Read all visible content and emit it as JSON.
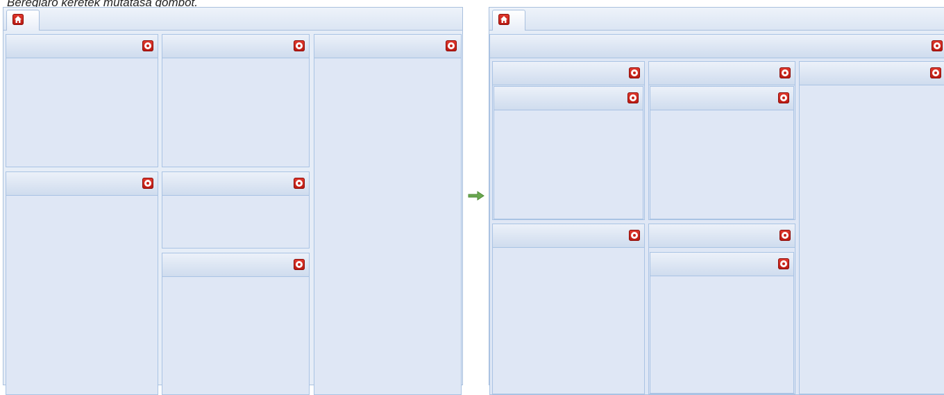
{
  "caption": "Beregiaro keretek mutatasa gombot.",
  "icons": {
    "home": "home-icon",
    "panel_settings": "gear-icon",
    "transition": "right-arrow-icon"
  },
  "colors": {
    "button_red": "#c9231a",
    "panel_fill": "#dfe7f5",
    "panel_border": "#a9c3e4",
    "arrow_green": "#6aa84f"
  }
}
